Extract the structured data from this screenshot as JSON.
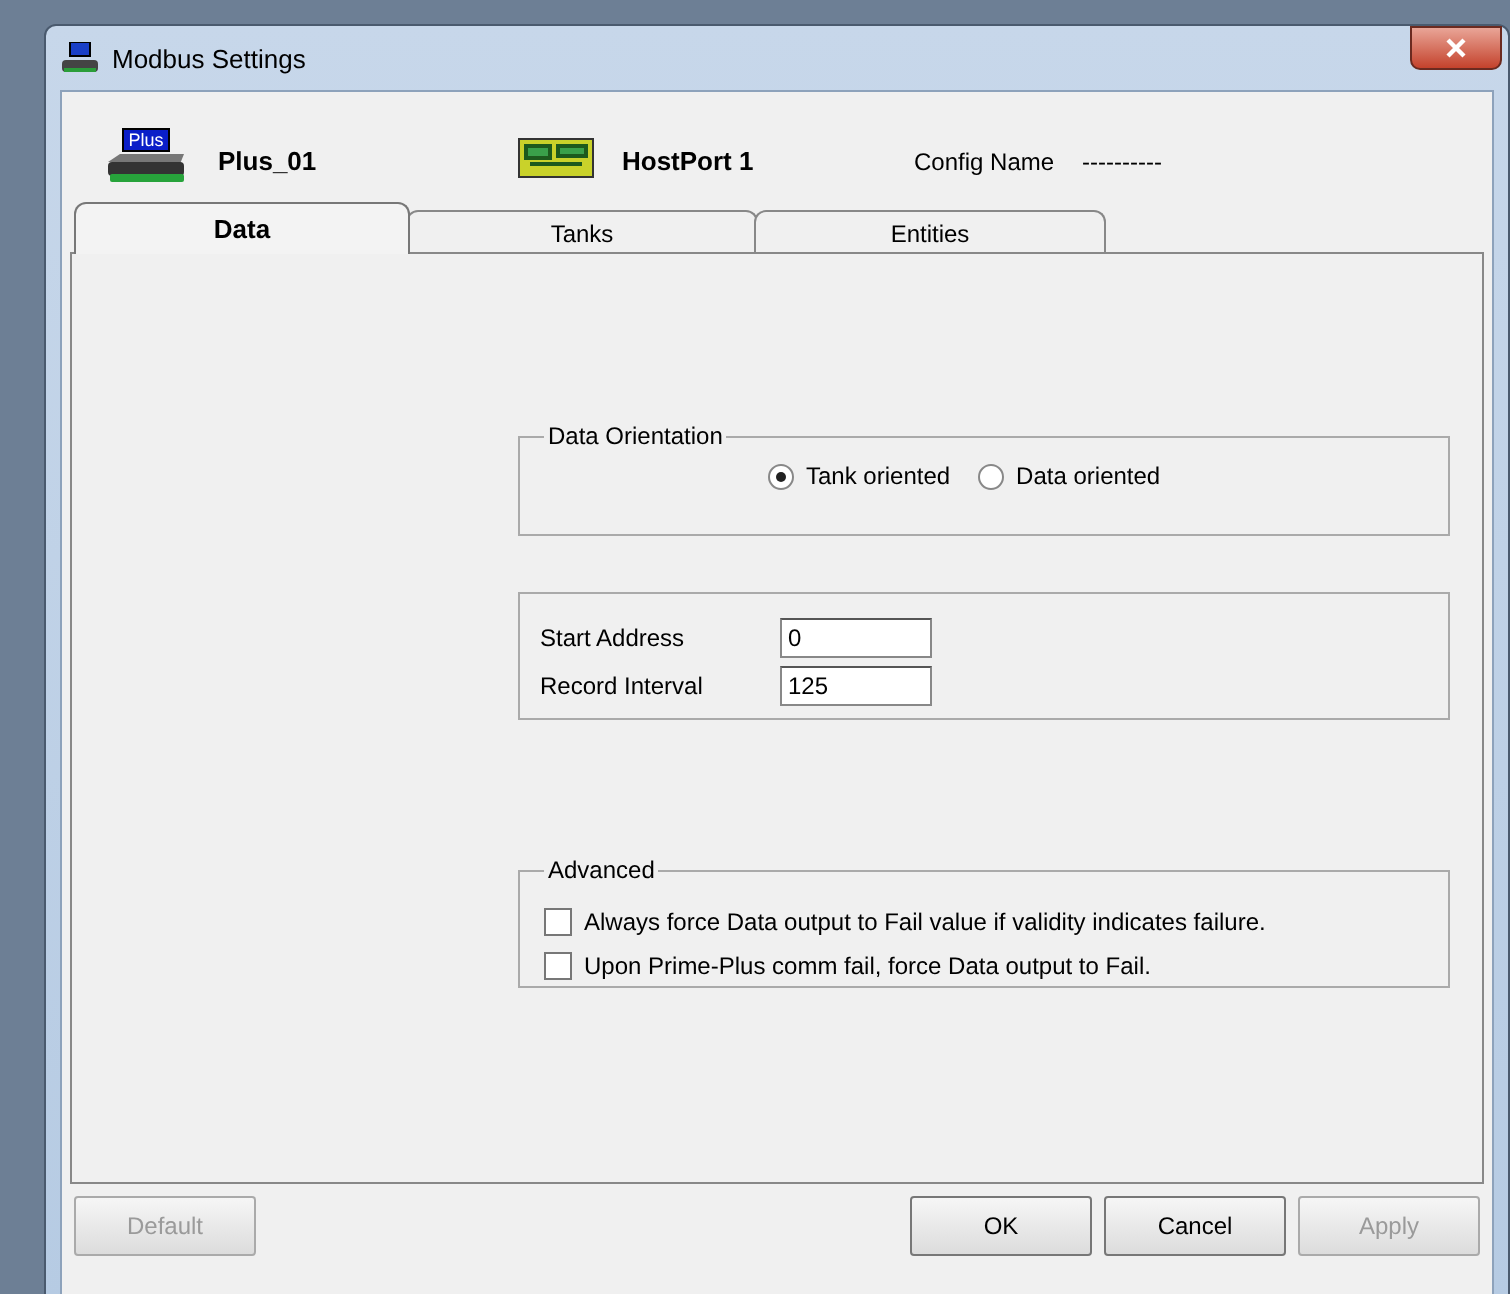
{
  "window": {
    "title": "Modbus Settings"
  },
  "header": {
    "device_badge": "Plus",
    "device": "Plus_01",
    "port": "HostPort 1",
    "config_label": "Config Name",
    "config_value": "----------"
  },
  "tabs": [
    {
      "label": "Data",
      "selected": true
    },
    {
      "label": "Tanks",
      "selected": false
    },
    {
      "label": "Entities",
      "selected": false
    }
  ],
  "orientation": {
    "title": "Data Orientation",
    "options": [
      {
        "label": "Tank oriented",
        "selected": true
      },
      {
        "label": "Data oriented",
        "selected": false
      }
    ]
  },
  "fields": [
    {
      "label": "Start Address",
      "value": "0"
    },
    {
      "label": "Record Interval",
      "value": "125"
    }
  ],
  "advanced": {
    "title": "Advanced",
    "options": [
      {
        "label": "Always force Data output to Fail value if validity indicates failure.",
        "checked": false
      },
      {
        "label": "Upon Prime-Plus comm fail, force Data output to Fail.",
        "checked": false
      }
    ]
  },
  "buttons": [
    {
      "label": "Default",
      "disabled": true
    },
    {
      "label": "OK",
      "disabled": false
    },
    {
      "label": "Cancel",
      "disabled": false
    },
    {
      "label": "Apply",
      "disabled": true
    }
  ]
}
